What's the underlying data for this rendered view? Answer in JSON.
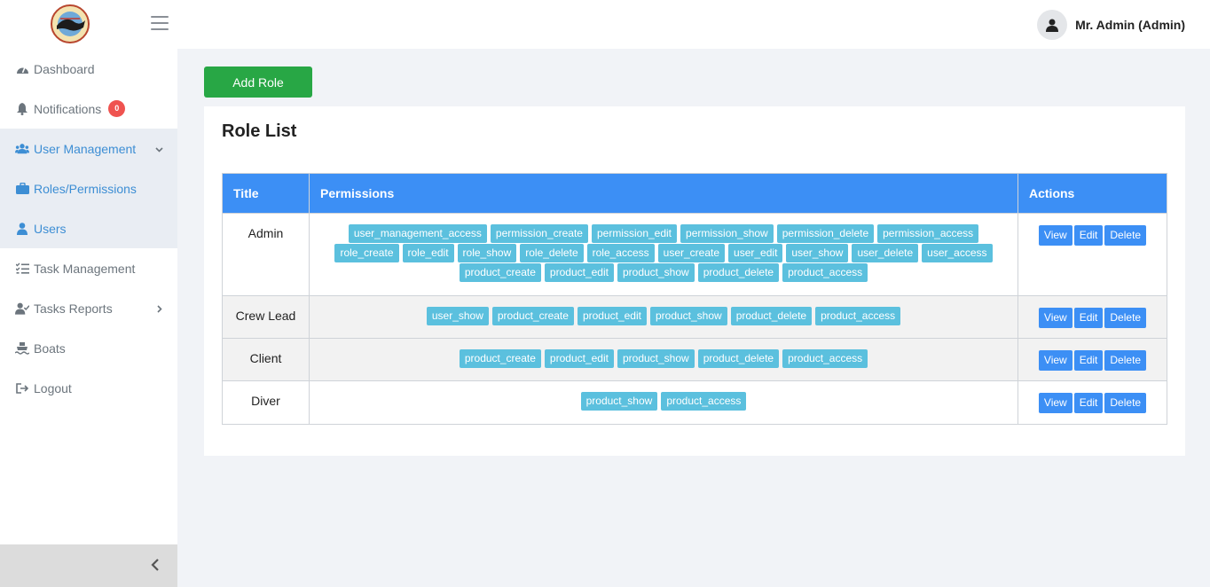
{
  "header": {
    "user_name": "Mr. Admin (Admin)"
  },
  "sidebar": {
    "items": [
      {
        "label": "Dashboard",
        "icon": "dashboard-icon"
      },
      {
        "label": "Notifications",
        "icon": "bell-icon",
        "badge": "0"
      },
      {
        "label": "User Management",
        "icon": "users-icon"
      },
      {
        "label": "Roles/Permissions",
        "icon": "briefcase-icon"
      },
      {
        "label": "Users",
        "icon": "user-icon"
      },
      {
        "label": "Task Management",
        "icon": "tasks-icon"
      },
      {
        "label": "Tasks Reports",
        "icon": "user-check-icon"
      },
      {
        "label": "Boats",
        "icon": "ship-icon"
      },
      {
        "label": "Logout",
        "icon": "logout-icon"
      }
    ]
  },
  "main": {
    "add_role_label": "Add Role",
    "card_title": "Role List",
    "columns": [
      "Title",
      "Permissions",
      "Actions"
    ],
    "actions": [
      "View",
      "Edit",
      "Delete"
    ],
    "rows": [
      {
        "title": "Admin",
        "permissions": [
          "user_management_access",
          "permission_create",
          "permission_edit",
          "permission_show",
          "permission_delete",
          "permission_access",
          "role_create",
          "role_edit",
          "role_show",
          "role_delete",
          "role_access",
          "user_create",
          "user_edit",
          "user_show",
          "user_delete",
          "user_access",
          "product_create",
          "product_edit",
          "product_show",
          "product_delete",
          "product_access"
        ]
      },
      {
        "title": "Crew Lead",
        "permissions": [
          "user_show",
          "product_create",
          "product_edit",
          "product_show",
          "product_delete",
          "product_access"
        ]
      },
      {
        "title": "Client",
        "permissions": [
          "product_create",
          "product_edit",
          "product_show",
          "product_delete",
          "product_access"
        ]
      },
      {
        "title": "Diver",
        "permissions": [
          "product_show",
          "product_access"
        ]
      }
    ]
  },
  "colors": {
    "add_button": "#28a745",
    "table_header": "#3c8ff5",
    "permission_badge": "#5bc0de",
    "notification_badge": "#ef5350",
    "active_nav": "#3d8ed4"
  }
}
